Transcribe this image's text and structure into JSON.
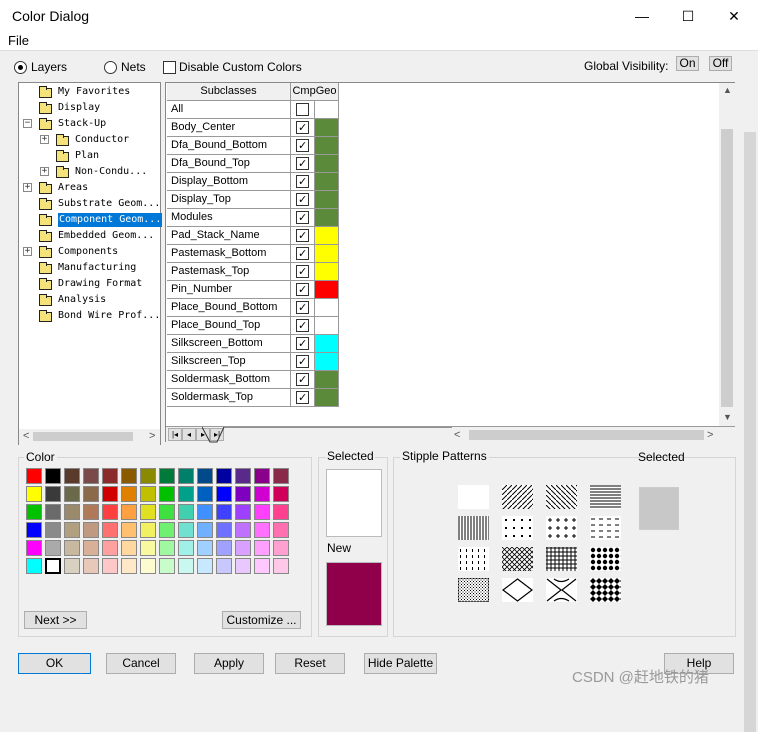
{
  "window": {
    "title": "Color Dialog",
    "minimize": "—",
    "maximize": "☐",
    "close": "✕"
  },
  "menu": {
    "file": "File"
  },
  "top": {
    "layers": "Layers",
    "nets": "Nets",
    "disable_custom": "Disable Custom Colors",
    "global_visibility": "Global Visibility:",
    "on": "On",
    "off": "Off"
  },
  "tree": {
    "items": [
      {
        "label": "My Favorites",
        "indent": 1,
        "expander": false
      },
      {
        "label": "Display",
        "indent": 1,
        "expander": false
      },
      {
        "label": "Stack-Up",
        "indent": 1,
        "expander": "minus"
      },
      {
        "label": "Conductor",
        "indent": 2,
        "expander": "plus"
      },
      {
        "label": "Plan",
        "indent": 2,
        "expander": false
      },
      {
        "label": "Non-Condu...",
        "indent": 2,
        "expander": "plus"
      },
      {
        "label": "Areas",
        "indent": 1,
        "expander": "plus"
      },
      {
        "label": "Substrate Geom...",
        "indent": 1,
        "expander": false
      },
      {
        "label": "Component Geom...",
        "indent": 1,
        "expander": false,
        "selected": true
      },
      {
        "label": "Embedded Geom...",
        "indent": 1,
        "expander": false
      },
      {
        "label": "Components",
        "indent": 1,
        "expander": "plus"
      },
      {
        "label": "Manufacturing",
        "indent": 1,
        "expander": false
      },
      {
        "label": "Drawing Format",
        "indent": 1,
        "expander": false
      },
      {
        "label": "Analysis",
        "indent": 1,
        "expander": false
      },
      {
        "label": "Bond Wire Prof...",
        "indent": 1,
        "expander": false
      }
    ]
  },
  "grid": {
    "header_subclasses": "Subclasses",
    "header_cmpgeo": "CmpGeo",
    "rows": [
      {
        "name": "All",
        "checked": false,
        "color": "#ffffff"
      },
      {
        "name": "Body_Center",
        "checked": true,
        "color": "#5a8a3a"
      },
      {
        "name": "Dfa_Bound_Bottom",
        "checked": true,
        "color": "#5a8a3a"
      },
      {
        "name": "Dfa_Bound_Top",
        "checked": true,
        "color": "#5a8a3a"
      },
      {
        "name": "Display_Bottom",
        "checked": true,
        "color": "#5a8a3a"
      },
      {
        "name": "Display_Top",
        "checked": true,
        "color": "#5a8a3a"
      },
      {
        "name": "Modules",
        "checked": true,
        "color": "#5a8a3a"
      },
      {
        "name": "Pad_Stack_Name",
        "checked": true,
        "color": "#ffff00"
      },
      {
        "name": "Pastemask_Bottom",
        "checked": true,
        "color": "#ffff00"
      },
      {
        "name": "Pastemask_Top",
        "checked": true,
        "color": "#ffff00"
      },
      {
        "name": "Pin_Number",
        "checked": true,
        "color": "#ff0000"
      },
      {
        "name": "Place_Bound_Bottom",
        "checked": true,
        "color": "#ffffff"
      },
      {
        "name": "Place_Bound_Top",
        "checked": true,
        "color": "#ffffff"
      },
      {
        "name": "Silkscreen_Bottom",
        "checked": true,
        "color": "#00ffff"
      },
      {
        "name": "Silkscreen_Top",
        "checked": true,
        "color": "#00ffff"
      },
      {
        "name": "Soldermask_Bottom",
        "checked": true,
        "color": "#5a8a3a"
      },
      {
        "name": "Soldermask_Top",
        "checked": true,
        "color": "#5a8a3a"
      }
    ]
  },
  "color": {
    "label": "Color",
    "palette": [
      [
        "#ff0000",
        "#000000",
        "#5a3a2a",
        "#7a4a4a",
        "#8a2a2a",
        "#8a5a00",
        "#8a8a00",
        "#007a3a",
        "#00806a",
        "#004a8a",
        "#0000a0",
        "#5a2a8a",
        "#8a008a",
        "#8a2a4a"
      ],
      [
        "#ffff00",
        "#3a3a3a",
        "#6a6a4a",
        "#8a6a4a",
        "#d00000",
        "#e08000",
        "#c0c000",
        "#00c000",
        "#00a08a",
        "#0060c0",
        "#0000ff",
        "#8000c0",
        "#d000d0",
        "#d0005a"
      ],
      [
        "#00c000",
        "#6a6a6a",
        "#9a8a6a",
        "#b07a5a",
        "#ff4040",
        "#ffa040",
        "#e0e020",
        "#40e040",
        "#40d0b0",
        "#4090ff",
        "#4040ff",
        "#a040ff",
        "#ff40ff",
        "#ff4090"
      ],
      [
        "#0000ff",
        "#8a8a8a",
        "#b0a080",
        "#c09a80",
        "#ff7070",
        "#ffc070",
        "#f0f060",
        "#70f070",
        "#70e0d0",
        "#70b0ff",
        "#7070ff",
        "#c070ff",
        "#ff70ff",
        "#ff70b0"
      ],
      [
        "#ff00ff",
        "#aaaaaa",
        "#c8b8a0",
        "#d8b098",
        "#ffa0a0",
        "#ffd8a0",
        "#f8f8a0",
        "#a0f8a0",
        "#a0f0e8",
        "#a0d0ff",
        "#a0a0ff",
        "#d8a0ff",
        "#ffa0ff",
        "#ffa0d0"
      ],
      [
        "#00ffff",
        "#ffffff",
        "#d8d0c0",
        "#e8c8b8",
        "#ffc8c8",
        "#ffe8c8",
        "#fcfcd0",
        "#c8fcc8",
        "#c8f8f0",
        "#c8e8ff",
        "#c8c8ff",
        "#e8c8ff",
        "#ffc8ff",
        "#ffc8e8"
      ]
    ],
    "selected_swatch": [
      5,
      1
    ],
    "next": "Next >>",
    "customize": "Customize ..."
  },
  "selected": {
    "label": "Selected",
    "selected_color": "#ffffff",
    "new_label": "New",
    "new_color": "#90004a"
  },
  "stipple": {
    "label": "Stipple Patterns",
    "selected_label": "Selected",
    "selected_color": "#c8c8c8",
    "patterns": [
      "solid-white",
      "diag-right",
      "diag-left",
      "horizontal",
      "vertical",
      "sparse-dots",
      "plus-dots",
      "dashes",
      "dots-grid",
      "crosshatch-diag",
      "grid",
      "checker",
      "dots-dense",
      "diamond",
      "wave-lattice",
      "checker-dense"
    ]
  },
  "buttons": {
    "ok": "OK",
    "cancel": "Cancel",
    "apply": "Apply",
    "reset": "Reset",
    "hide_palette": "Hide Palette",
    "help": "Help"
  },
  "watermark": "CSDN @赶地铁的猪"
}
